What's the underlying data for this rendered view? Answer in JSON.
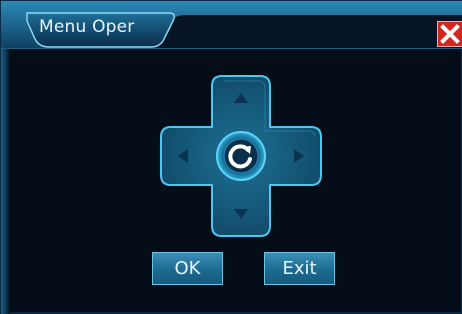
{
  "window": {
    "title": "Menu Oper",
    "close_icon": "close-x-icon"
  },
  "dpad": {
    "up_icon": "arrow-up-icon",
    "down_icon": "arrow-down-icon",
    "left_icon": "arrow-left-icon",
    "right_icon": "arrow-right-icon",
    "center_icon": "refresh-icon"
  },
  "buttons": {
    "ok_label": "OK",
    "exit_label": "Exit"
  },
  "colors": {
    "accent": "#2fb8e6",
    "close": "#d3261f",
    "background": "#050d18"
  }
}
